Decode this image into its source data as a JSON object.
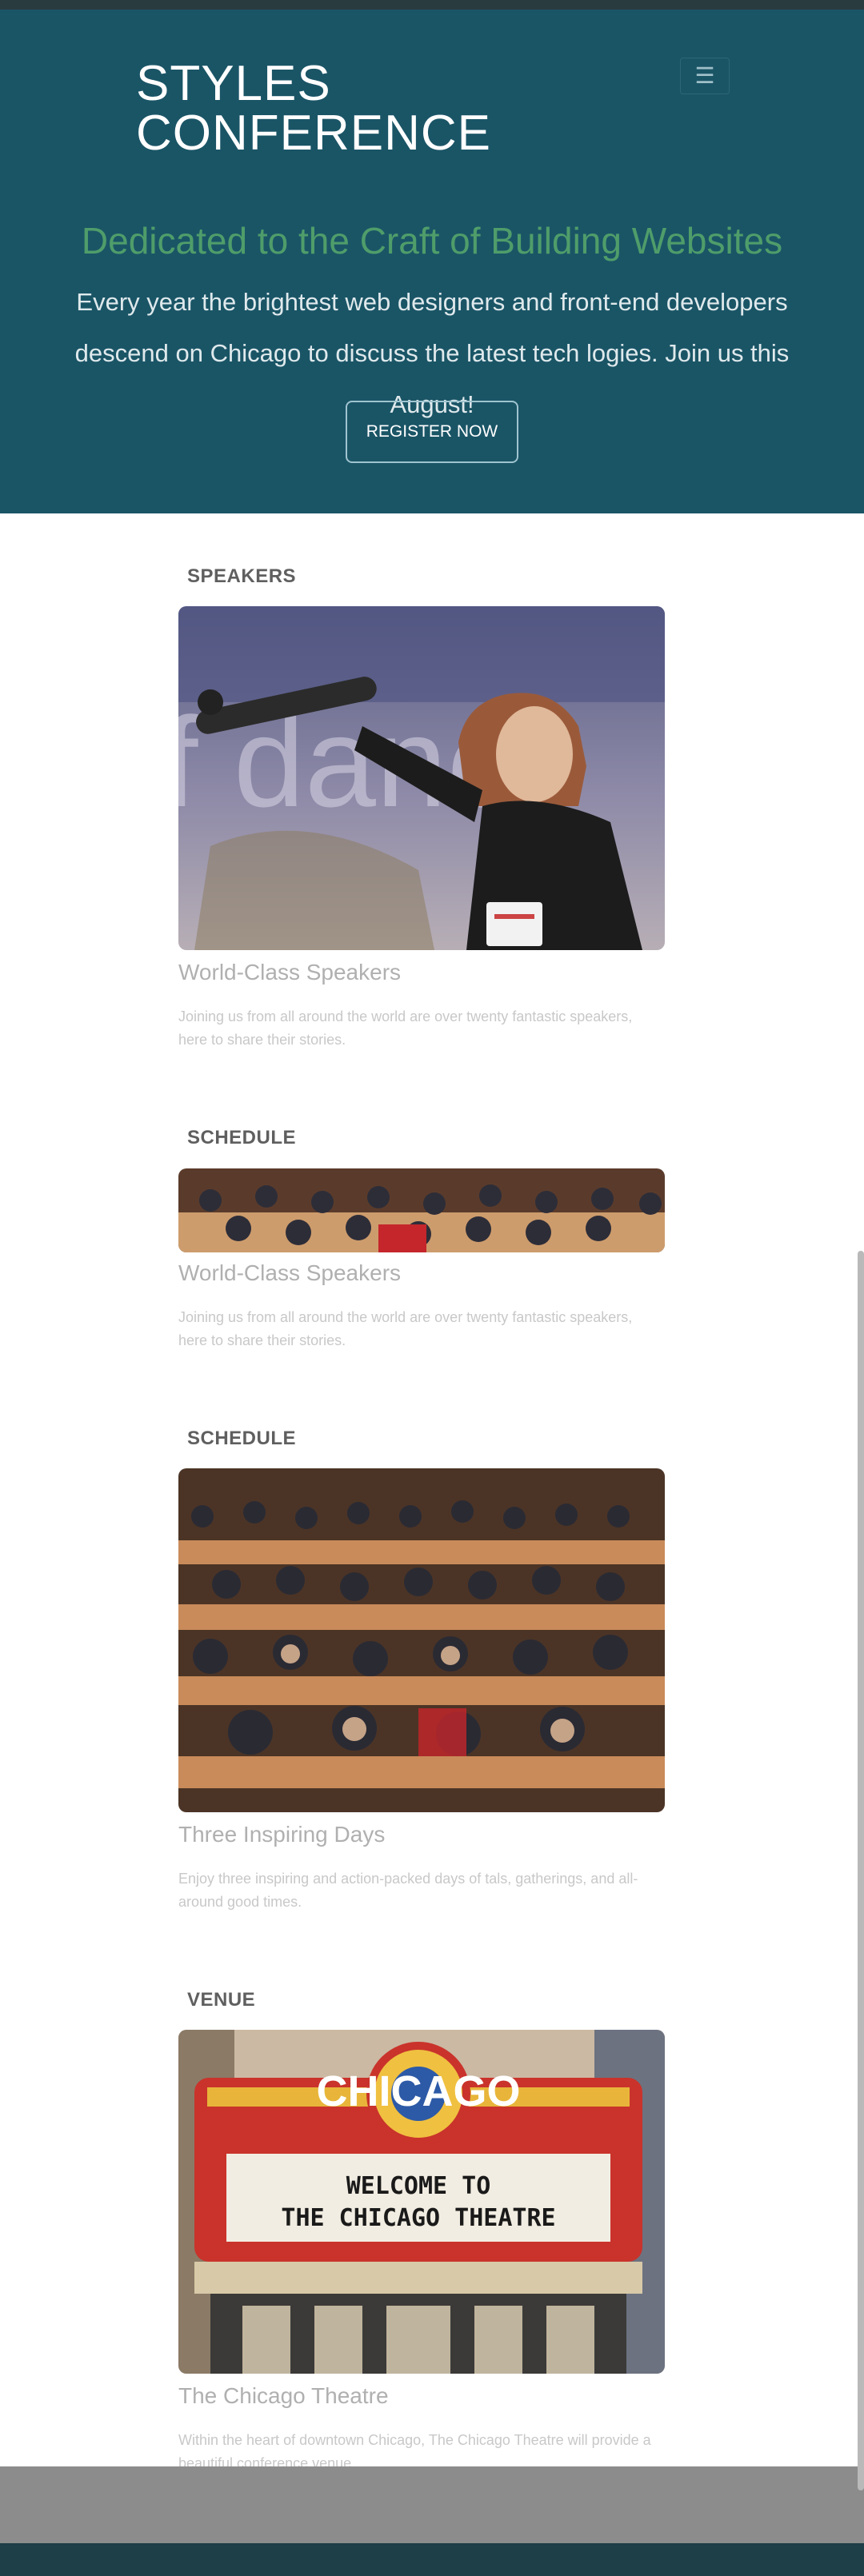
{
  "header": {
    "brand_line1": "STYLES",
    "brand_line2": "CONFERENCE",
    "menu_icon": "hamburger-icon"
  },
  "hero": {
    "title": "Dedicated to the Craft of Building Websites",
    "text": "Every year the brightest web designers and front-end developers descend on Chicago to discuss the latest tech logies. Join us this August!",
    "cta": "REGISTER NOW"
  },
  "sections": [
    {
      "heading": "SPEAKERS",
      "card_title": "World-Class Speakers",
      "card_text": "Joining us from all around the world are over twenty fantastic speakers, here to share their stories."
    },
    {
      "heading": "SCHEDULE",
      "card_title": "World-Class Speakers",
      "card_text": "Joining us from all around the world are over twenty fantastic speakers, here to share their stories."
    },
    {
      "heading": "SCHEDULE",
      "card_title": "Three Inspiring Days",
      "card_text": "Enjoy three inspiring and action-packed days of tals, gatherings, and all-around good times."
    },
    {
      "heading": "VENUE",
      "card_title": "The Chicago Theatre",
      "card_text": "Within the heart of downtown Chicago, The Chicago Theatre will provide a beautiful conference venue."
    }
  ],
  "venue_photo": {
    "marquee_sign": "CHICAGO",
    "marquee_line1": "WELCOME TO",
    "marquee_line2": "THE CHICAGO THEATRE"
  },
  "colors": {
    "hero_bg": "#1a5566",
    "accent_green": "#4f9d6a",
    "footer_bg": "#1e3e48"
  }
}
